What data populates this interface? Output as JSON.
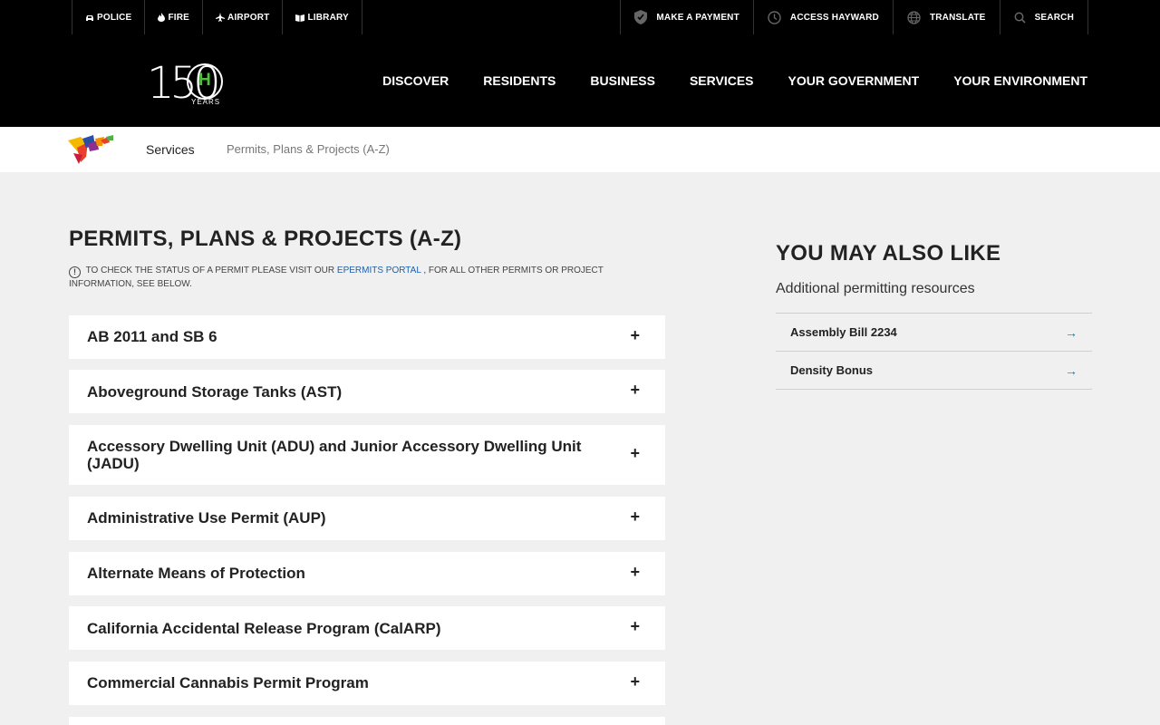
{
  "utility_bar": {
    "left": [
      {
        "label": "POLICE",
        "icon": "police-car-icon"
      },
      {
        "label": "FIRE",
        "icon": "flame-icon"
      },
      {
        "label": "AIRPORT",
        "icon": "airplane-icon"
      },
      {
        "label": "LIBRARY",
        "icon": "book-icon"
      }
    ],
    "right": [
      {
        "label": "MAKE A PAYMENT",
        "icon": "shield-check-icon"
      },
      {
        "label": "ACCESS HAYWARD",
        "icon": "clock-icon"
      },
      {
        "label": "TRANSLATE",
        "icon": "globe-icon"
      },
      {
        "label": "SEARCH",
        "icon": "search-icon"
      }
    ]
  },
  "logo": {
    "number": "150",
    "letter": "H",
    "caption": "YEARS"
  },
  "nav": [
    "DISCOVER",
    "RESIDENTS",
    "BUSINESS",
    "SERVICES",
    "YOUR GOVERNMENT",
    "YOUR ENVIRONMENT"
  ],
  "breadcrumb": {
    "level1": "Services",
    "current": "Permits, Plans & Projects (A-Z)"
  },
  "main": {
    "title": "PERMITS, PLANS & PROJECTS (A-Z)",
    "notice_before": "To check the status of a permit please visit our",
    "notice_link": "ePermits Portal",
    "notice_after": ", for all other permits or project information, see below.",
    "accordion": [
      "AB 2011 and SB 6",
      "Aboveground Storage Tanks (AST)",
      "Accessory Dwelling Unit (ADU) and Junior Accessory Dwelling Unit (JADU)",
      "Administrative Use Permit (AUP)",
      "Alternate Means of Protection",
      "California Accidental Release Program (CalARP)",
      "Commercial Cannabis Permit Program"
    ],
    "expand_symbol": "+"
  },
  "sidebar": {
    "title": "YOU MAY ALSO LIKE",
    "subtitle": "Additional permitting resources",
    "links": [
      "Assembly Bill 2234",
      "Density Bonus"
    ],
    "arrow": "→"
  },
  "colors": {
    "header_bg": "#000000",
    "accent_green": "#4fc23c",
    "link_blue": "#1f5fa8",
    "arrow_teal": "#1e7a8c",
    "page_bg": "#f0f0f0"
  }
}
